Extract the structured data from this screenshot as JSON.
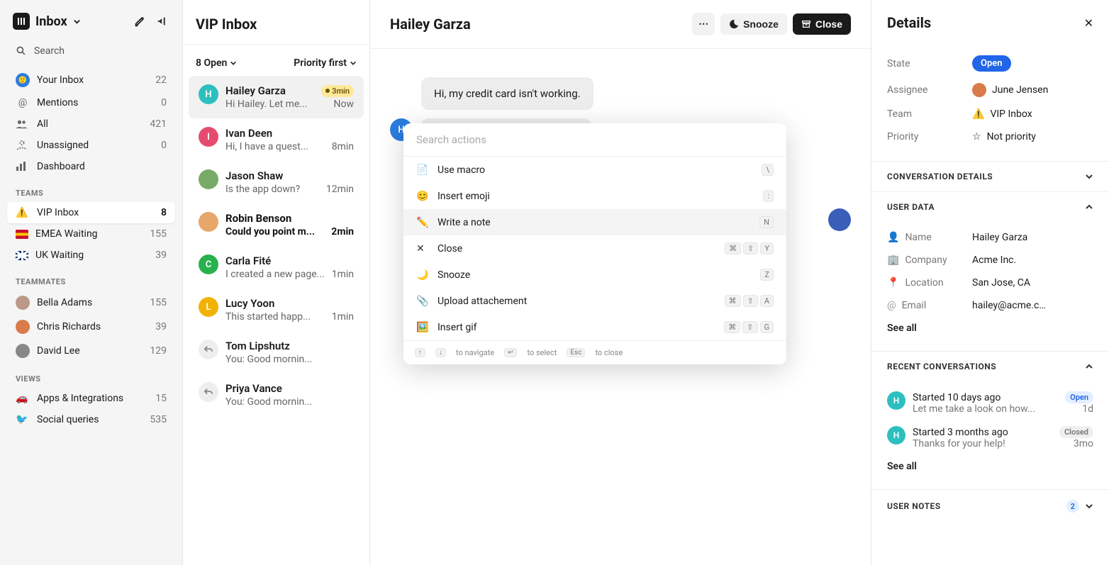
{
  "sidebar": {
    "brand": "Inbox",
    "search": "Search",
    "nav": [
      {
        "label": "Your Inbox",
        "count": "22"
      },
      {
        "label": "Mentions",
        "count": "0"
      },
      {
        "label": "All",
        "count": "421"
      },
      {
        "label": "Unassigned",
        "count": "0"
      },
      {
        "label": "Dashboard",
        "count": ""
      }
    ],
    "teams_label": "TEAMS",
    "teams": [
      {
        "label": "VIP Inbox",
        "count": "8"
      },
      {
        "label": "EMEA Waiting",
        "count": "155"
      },
      {
        "label": "UK Waiting",
        "count": "39"
      }
    ],
    "teammates_label": "TEAMMATES",
    "teammates": [
      {
        "label": "Bella Adams",
        "count": "155"
      },
      {
        "label": "Chris Richards",
        "count": "39"
      },
      {
        "label": "David Lee",
        "count": "129"
      }
    ],
    "views_label": "VIEWS",
    "views": [
      {
        "label": "Apps & Integrations",
        "count": "15"
      },
      {
        "label": "Social queries",
        "count": "535"
      }
    ]
  },
  "list": {
    "title": "VIP Inbox",
    "open_filter": "8 Open",
    "sort": "Priority first",
    "items": [
      {
        "initial": "H",
        "color": "#2dbfbf",
        "name": "Hailey Garza",
        "preview": "Hi Hailey. Let me...",
        "time": "Now",
        "badge": "3min"
      },
      {
        "initial": "I",
        "color": "#e64b6f",
        "name": "Ivan Deen",
        "preview": "Hi, I have a quest...",
        "time": "8min"
      },
      {
        "initial": "",
        "color": "",
        "name": "Jason Shaw",
        "preview": "Is the app down?",
        "time": "12min",
        "img": true
      },
      {
        "initial": "",
        "color": "",
        "name": "Robin Benson",
        "preview": "Could you point m...",
        "time": "2min",
        "img": true,
        "bold": true
      },
      {
        "initial": "C",
        "color": "#28b14c",
        "name": "Carla Fité",
        "preview": "I created a new page...",
        "time": "1min"
      },
      {
        "initial": "L",
        "color": "#f2b203",
        "name": "Lucy Yoon",
        "preview": "This started happ...",
        "time": "1min"
      },
      {
        "initial": "↩",
        "color": "",
        "name": "Tom Lipshutz",
        "preview": "You: Good mornin...",
        "time": "",
        "replied": true
      },
      {
        "initial": "↩",
        "color": "",
        "name": "Priya Vance",
        "preview": "You: Good mornin...",
        "time": "",
        "replied": true
      }
    ]
  },
  "conv": {
    "title": "Hailey Garza",
    "snooze": "Snooze",
    "close": "Close",
    "msg1": "Hi, my credit card isn't working.",
    "avatar_initial": "H"
  },
  "palette": {
    "placeholder": "Search actions",
    "items": [
      {
        "label": "Use macro",
        "shortcut": [
          "\\"
        ]
      },
      {
        "label": "Insert emoji",
        "shortcut": [
          ":"
        ]
      },
      {
        "label": "Write a note",
        "shortcut": [
          "N"
        ]
      },
      {
        "label": "Close",
        "shortcut": [
          "⌘",
          "⇧",
          "Y"
        ]
      },
      {
        "label": "Snooze",
        "shortcut": [
          "Z"
        ]
      },
      {
        "label": "Upload attachement",
        "shortcut": [
          "⌘",
          "⇧",
          "A"
        ]
      },
      {
        "label": "Insert gif",
        "shortcut": [
          "⌘",
          "⇧",
          "G"
        ]
      }
    ],
    "footer": {
      "navigate": "to navigate",
      "select": "to select",
      "close": "to close",
      "esc": "Esc",
      "enter": "↵",
      "up": "↑",
      "down": "↓"
    }
  },
  "details": {
    "title": "Details",
    "state_label": "State",
    "state": "Open",
    "assignee_label": "Assignee",
    "assignee": "June Jensen",
    "team_label": "Team",
    "team": "VIP Inbox",
    "priority_label": "Priority",
    "priority": "Not priority",
    "conv_details": "CONVERSATION DETAILS",
    "user_data": "USER DATA",
    "user": {
      "name_label": "Name",
      "name": "Hailey Garza",
      "company_label": "Company",
      "company": "Acme Inc.",
      "location_label": "Location",
      "location": "San Jose, CA",
      "email_label": "Email",
      "email": "hailey@acme.c…"
    },
    "see_all": "See all",
    "recent": "RECENT CONVERSATIONS",
    "recents": [
      {
        "title": "Started 10 days ago",
        "sub": "Let me take a look on how...",
        "status": "Open",
        "time": "1d"
      },
      {
        "title": "Started 3 months ago",
        "sub": "Thanks for your help!",
        "status": "Closed",
        "time": "3mo"
      }
    ],
    "user_notes": "USER NOTES",
    "notes_count": "2"
  }
}
